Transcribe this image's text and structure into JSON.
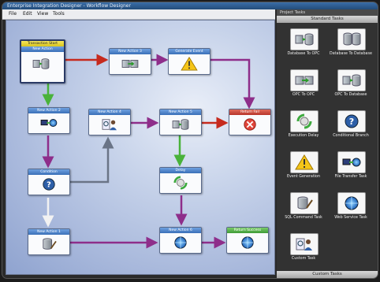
{
  "window": {
    "title": "Enterprise Integration Designer - Workflow Designer"
  },
  "menu": [
    "File",
    "Edit",
    "View",
    "Tools"
  ],
  "nodes": {
    "start": {
      "label": "Transaction Start",
      "sub": "New Action"
    },
    "action3": {
      "label": "New Action 3"
    },
    "generate_event": {
      "label": "Generate Event"
    },
    "action2": {
      "label": "New Action 2"
    },
    "action4": {
      "label": "New Action 4"
    },
    "action5": {
      "label": "New Action 5"
    },
    "return_fail": {
      "label": "Return Fail"
    },
    "condition": {
      "label": "Condition"
    },
    "delay": {
      "label": "Delay"
    },
    "action1": {
      "label": "New Action 1"
    },
    "action6": {
      "label": "New Action 6"
    },
    "return_success": {
      "label": "Return Success"
    }
  },
  "panel": {
    "title": "Project Tasks",
    "standard_tab": "Standard Tasks",
    "custom_tab": "Custom Tasks",
    "tools": [
      {
        "label": "Database To OPC",
        "icon": "database-to-opc-icon"
      },
      {
        "label": "Database To Database",
        "icon": "database-to-database-icon"
      },
      {
        "label": "OPC To OPC",
        "icon": "opc-to-opc-icon"
      },
      {
        "label": "OPC To Database",
        "icon": "opc-to-database-icon"
      },
      {
        "label": "Execution Delay",
        "icon": "execution-delay-icon"
      },
      {
        "label": "Conditional Branch",
        "icon": "conditional-branch-icon"
      },
      {
        "label": "Event Generation",
        "icon": "event-generation-icon"
      },
      {
        "label": "File Transfer Task",
        "icon": "file-transfer-icon"
      },
      {
        "label": "SQL Command Task",
        "icon": "sql-command-icon"
      },
      {
        "label": "Web Service Task",
        "icon": "web-service-icon"
      },
      {
        "label": "Custom Task",
        "icon": "custom-task-icon"
      }
    ]
  },
  "colors": {
    "flow": "#8e2e8a",
    "fail": "#c62a1e",
    "success": "#49b23a",
    "alt": "#6a7486",
    "panel": "#323232"
  }
}
